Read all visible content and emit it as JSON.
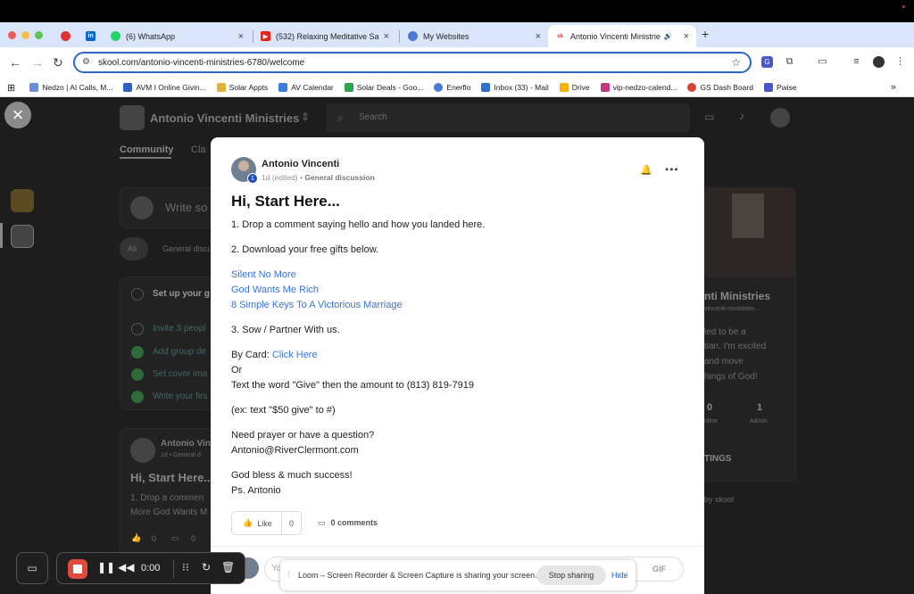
{
  "browser": {
    "tabs": [
      {
        "label": "(6) WhatsApp"
      },
      {
        "label": "(532) Relaxing Meditative Sa"
      },
      {
        "label": "My Websites"
      },
      {
        "label": "Antonio Vincenti Ministrie"
      }
    ],
    "url": "skool.com/antonio-vincenti-ministries-6780/welcome",
    "bookmarks": [
      {
        "label": "Nedzo | AI Calls, M...",
        "color": "#6a8fd6"
      },
      {
        "label": "AVM I Online Givin...",
        "color": "#2f5fc4"
      },
      {
        "label": "Solar Appts",
        "color": "#e2b33a"
      },
      {
        "label": "AV Calendar",
        "color": "#3c7de0"
      },
      {
        "label": "Solar Deals - Goo...",
        "color": "#2ea44f"
      },
      {
        "label": "Enerflo",
        "color": "#4a7bd4"
      },
      {
        "label": "Inbox (33) - Mail",
        "color": "#2f6fd4"
      },
      {
        "label": "Drive",
        "color": "#f4b400"
      },
      {
        "label": "vip-nedzo-calend...",
        "color": "#c53a7e"
      },
      {
        "label": "GS Dash Board",
        "color": "#d64532"
      },
      {
        "label": "Pwise",
        "color": "#4b57c9"
      }
    ]
  },
  "background": {
    "group_name": "Antonio Vincenti Ministries",
    "search_placeholder": "Search",
    "tabs": [
      "Community",
      "Cla"
    ],
    "write_placeholder": "Write so",
    "filters": [
      "All",
      "General discussion"
    ],
    "setup_title": "Set up your g",
    "setup_items": [
      "Invite 3 peopl",
      "Add group de",
      "Set cover ima",
      "Write your firs"
    ],
    "post_author": "Antonio Vincenti",
    "post_meta": "1d • General d",
    "post_title": "Hi, Start Here...",
    "post_preview_1": "1. Drop a commen",
    "post_preview_2": "More God Wants M",
    "post_likes": "0",
    "post_comments": "0",
    "side_name": "nti Ministries",
    "side_url": "vincenti-ministries-...",
    "side_desc_1": "led to be a",
    "side_desc_2": "tian. I'm excited",
    "side_desc_3": "and move",
    "side_desc_4": "hings of God!",
    "side_stat_1": "0",
    "side_stat_2": "1",
    "side_stat_label_1": "nline",
    "side_stat_label_2": "Admin",
    "side_settings": "TINGS",
    "side_powered": "by skool"
  },
  "post": {
    "author": "Antonio Vincenti",
    "level": "1",
    "time": "1d (edited)",
    "separator": " • ",
    "category": "General discussion",
    "title": "Hi, Start Here...",
    "step1": "1. Drop a comment saying hello and how you landed here.",
    "step2": "2. Download your free gifts below.",
    "links": [
      "Silent No More",
      "God Wants Me Rich",
      "8 Simple Keys To A Victorious Marriage"
    ],
    "step3": "3. Sow / Partner With us.",
    "by_card": "By Card: ",
    "click_here": "Click Here",
    "or": "Or",
    "text_give": "Text the word \"Give\" then the amount to (813) 819-7919",
    "example": "(ex: text \"$50 give\" to #)",
    "prayer_q": "Need prayer or have a question?",
    "email": "Antonio@RiverClermont.com",
    "blessing": "God bless & much success!",
    "signature": "Ps. Antonio",
    "like_label": "Like",
    "like_count": "0",
    "comments_label": "0 comments",
    "comment_placeholder": "Yo",
    "gif_label": "GIF"
  },
  "loom": {
    "timer": "0:00",
    "share_message": "Loom – Screen Recorder & Screen Capture is sharing your screen.",
    "stop_sharing": "Stop sharing",
    "hide": "Hide"
  }
}
